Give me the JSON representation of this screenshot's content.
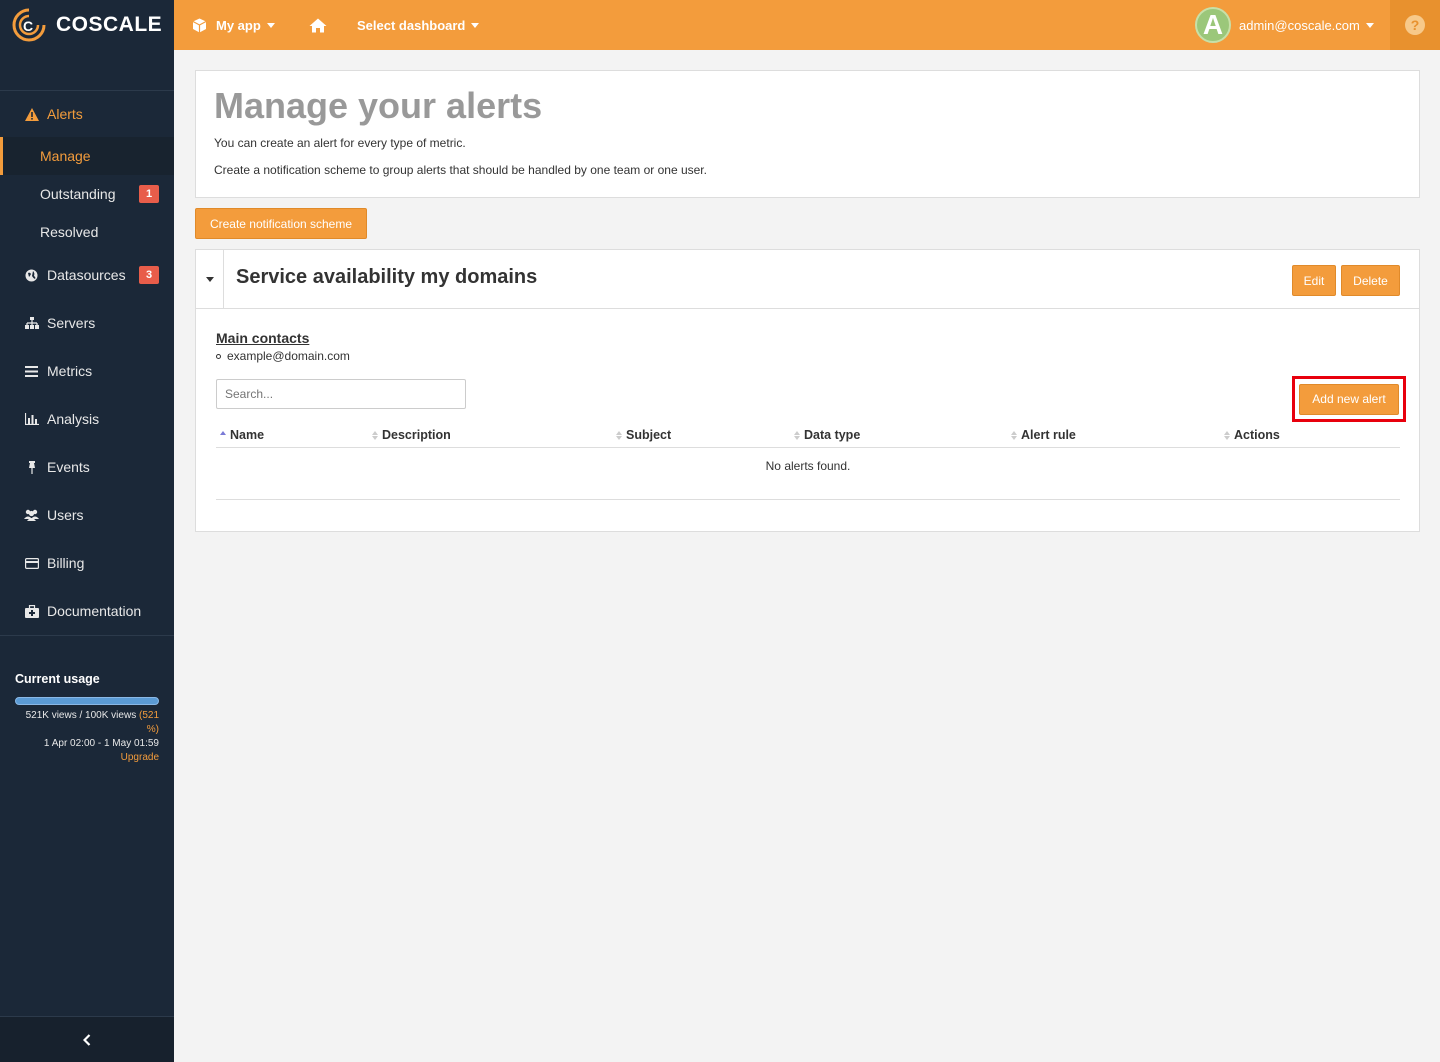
{
  "brand": {
    "name": "COSCALE",
    "accent": "#f39c3c",
    "sidebar_bg": "#1b2838"
  },
  "topbar": {
    "app_label": "My app",
    "dashboard_label": "Select dashboard",
    "avatar_letter": "A",
    "user_email": "admin@coscale.com",
    "help_symbol": "?"
  },
  "sidebar": {
    "alerts": {
      "label": "Alerts",
      "icon": "warning-icon",
      "sub": [
        {
          "label": "Manage",
          "active": true
        },
        {
          "label": "Outstanding",
          "badge": "1"
        },
        {
          "label": "Resolved"
        }
      ]
    },
    "items": [
      {
        "label": "Datasources",
        "icon": "globe-icon",
        "badge": "3"
      },
      {
        "label": "Servers",
        "icon": "sitemap-icon"
      },
      {
        "label": "Metrics",
        "icon": "list-icon"
      },
      {
        "label": "Analysis",
        "icon": "bar-chart-icon"
      },
      {
        "label": "Events",
        "icon": "pin-icon"
      },
      {
        "label": "Users",
        "icon": "users-icon"
      },
      {
        "label": "Billing",
        "icon": "credit-card-icon"
      },
      {
        "label": "Documentation",
        "icon": "first-aid-icon"
      }
    ],
    "usage": {
      "title": "Current usage",
      "views": "521K views / 100K views",
      "percent": "(521 %)",
      "fill_fraction": 1.0,
      "period": "1 Apr 02:00 - 1 May 01:59",
      "upgrade": "Upgrade"
    }
  },
  "header": {
    "title": "Manage your alerts",
    "line1": "You can create an alert for every type of metric.",
    "line2": "Create a notification scheme to group alerts that should be handled by one team or one user."
  },
  "create_button": "Create notification scheme",
  "scheme": {
    "title": "Service availability my domains",
    "edit": "Edit",
    "delete": "Delete",
    "contacts_title": "Main contacts",
    "contact": "example@domain.com",
    "search_placeholder": "Search...",
    "add_button": "Add new alert",
    "columns": [
      "Name",
      "Description",
      "Subject",
      "Data type",
      "Alert rule",
      "Actions"
    ],
    "empty": "No alerts found."
  }
}
